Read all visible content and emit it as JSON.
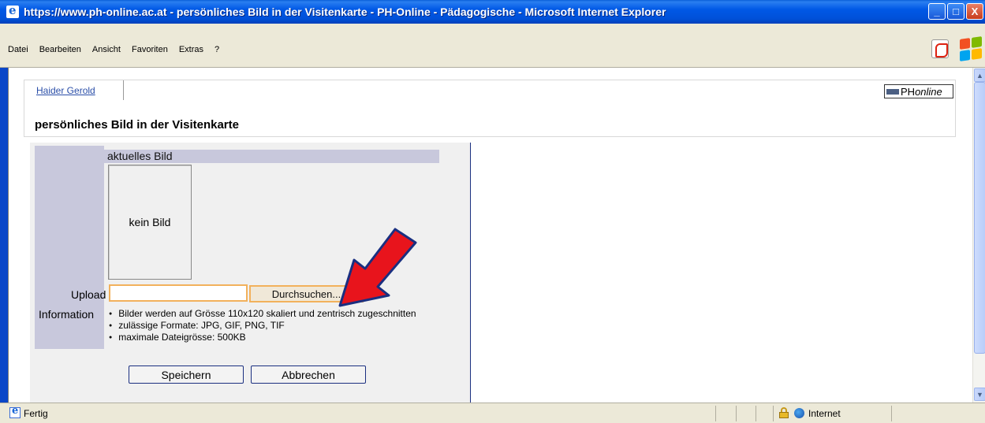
{
  "window": {
    "title": "https://www.ph-online.ac.at - persönliches Bild in der Visitenkarte - PH-Online - Pädagogische - Microsoft Internet Explorer",
    "minimize": "_",
    "maximize": "□",
    "close": "X"
  },
  "menu": {
    "items": [
      "Datei",
      "Bearbeiten",
      "Ansicht",
      "Favoriten",
      "Extras",
      "?"
    ]
  },
  "page": {
    "user_tab": "Haider Gerold",
    "brand_prefix": "PH",
    "brand_suffix": "online",
    "title": "persönliches Bild in der Visitenkarte"
  },
  "form": {
    "current_picture_header": "aktuelles Bild",
    "no_picture_text": "kein Bild",
    "upload_label": "Upload",
    "upload_value": "",
    "browse_button": "Durchsuchen...",
    "information_label": "Information",
    "info_items": [
      "Bilder werden auf Grösse 110x120 skaliert und zentrisch zugeschnitten",
      "zulässige Formate: JPG, GIF, PNG, TIF",
      "maximale Dateigrösse: 500KB"
    ],
    "save_button": "Speichern",
    "cancel_button": "Abbrechen"
  },
  "status": {
    "text": "Fertig",
    "zone": "Internet"
  },
  "colors": {
    "annotation_arrow": "#e8141c",
    "arrow_outline": "#1a2f80",
    "windows_flag": [
      "#f25022",
      "#7fba00",
      "#00a4ef",
      "#ffb900"
    ]
  }
}
